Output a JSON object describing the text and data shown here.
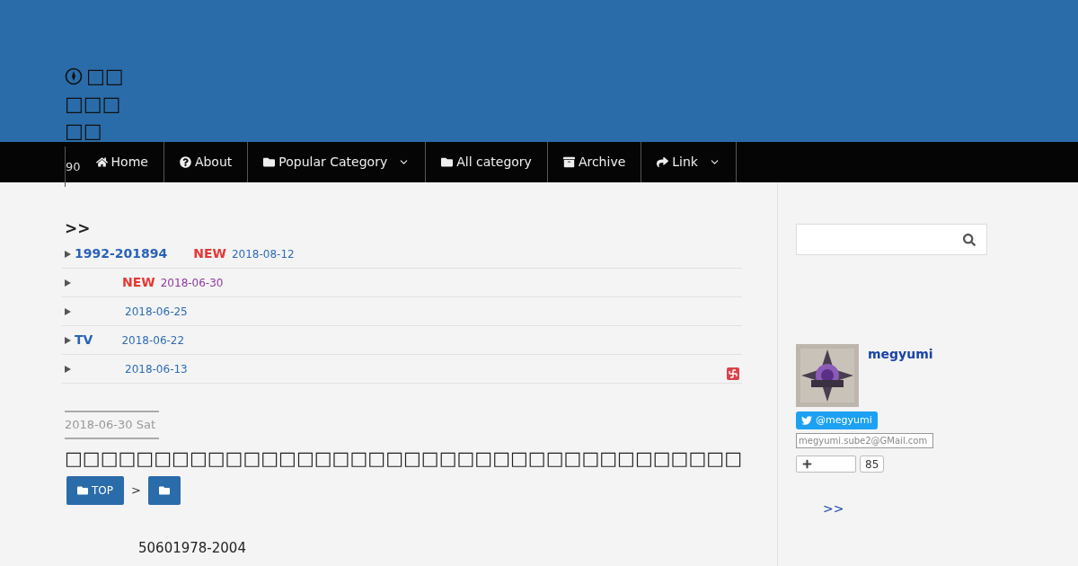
{
  "site": {
    "title_lines": [
      "□□",
      "□□□",
      "□□"
    ],
    "count": "90"
  },
  "nav": [
    {
      "label": "Home",
      "dropdown": false
    },
    {
      "label": "About",
      "dropdown": false
    },
    {
      "label": "Popular Category",
      "dropdown": true
    },
    {
      "label": "All category",
      "dropdown": false
    },
    {
      "label": "Archive",
      "dropdown": false
    },
    {
      "label": "Link",
      "dropdown": true
    }
  ],
  "recent": {
    "heading": ">>",
    "items": [
      {
        "title": "1992-201894",
        "new_badge": "NEW",
        "date": "2018-08-12",
        "visited": false,
        "flagged": false
      },
      {
        "new_badge": "NEW",
        "date": "2018-06-30",
        "visited": true,
        "flagged": false
      },
      {
        "date": "2018-06-25",
        "visited": false,
        "flagged": false
      },
      {
        "title": "TV",
        "date": "2018-06-22",
        "visited": false,
        "flagged": false
      },
      {
        "date": "2018-06-13",
        "visited": false,
        "flagged": true
      }
    ]
  },
  "article": {
    "date": "2018-06-30 Sat",
    "title": "□□□□□□□□□□□□□□□□□□□□□□□□□□□□□□□□□□□□□□",
    "breadcrumb": [
      {
        "kind": "top",
        "label": "TOP"
      },
      {
        "kind": "category"
      }
    ],
    "separator": ">",
    "body": "50601978-2004"
  },
  "sidebar": {
    "profile": {
      "name": "megyumi",
      "twitter": "@megyumi",
      "email": "megyumi.sube2@GMail.com",
      "follow_count": "85"
    },
    "more": ">>"
  }
}
